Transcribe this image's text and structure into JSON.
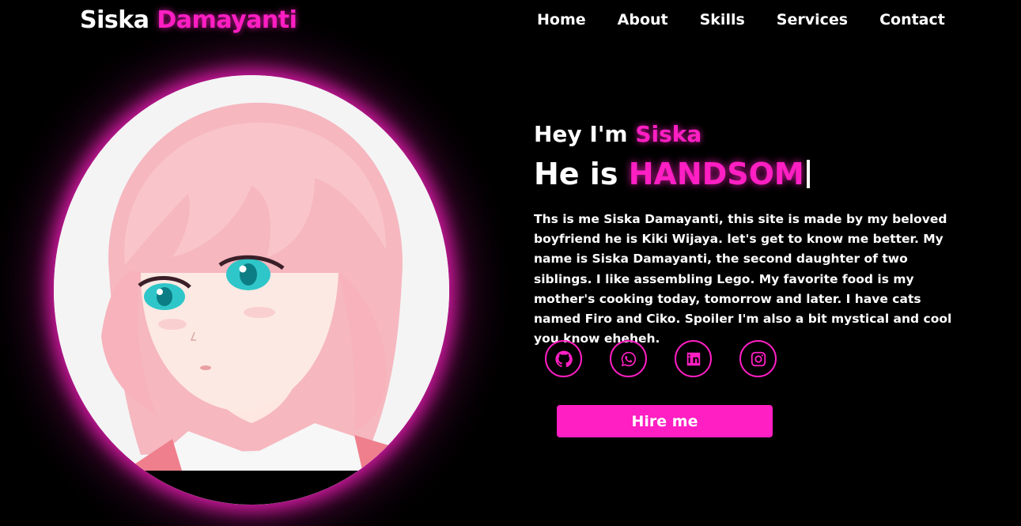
{
  "header": {
    "logo_first": "Siska",
    "logo_last": "Damayanti",
    "nav": [
      "Home",
      "About",
      "Skills",
      "Services",
      "Contact"
    ]
  },
  "hero": {
    "greeting_prefix": "Hey I'm",
    "greeting_name": "Siska",
    "role_prefix": "He is",
    "role_word": "HANDSOM",
    "bio": "Ths is me Siska Damayanti, this site is made by my beloved boyfriend he is Kiki Wijaya. let's get to know me better. My name is Siska Damayanti, the second daughter of two siblings. I like assembling Lego. My favorite food is my mother's cooking today, tomorrow and later. I have cats named Firo and Ciko. Spoiler I'm also a bit mystical and cool you know eheheh.",
    "social_icons": [
      "github-icon",
      "whatsapp-icon",
      "linkedin-icon",
      "instagram-icon"
    ],
    "hire_label": "Hire me"
  },
  "colors": {
    "background": "#000000",
    "accent": "#ff1fc3",
    "text": "#ffffff"
  }
}
